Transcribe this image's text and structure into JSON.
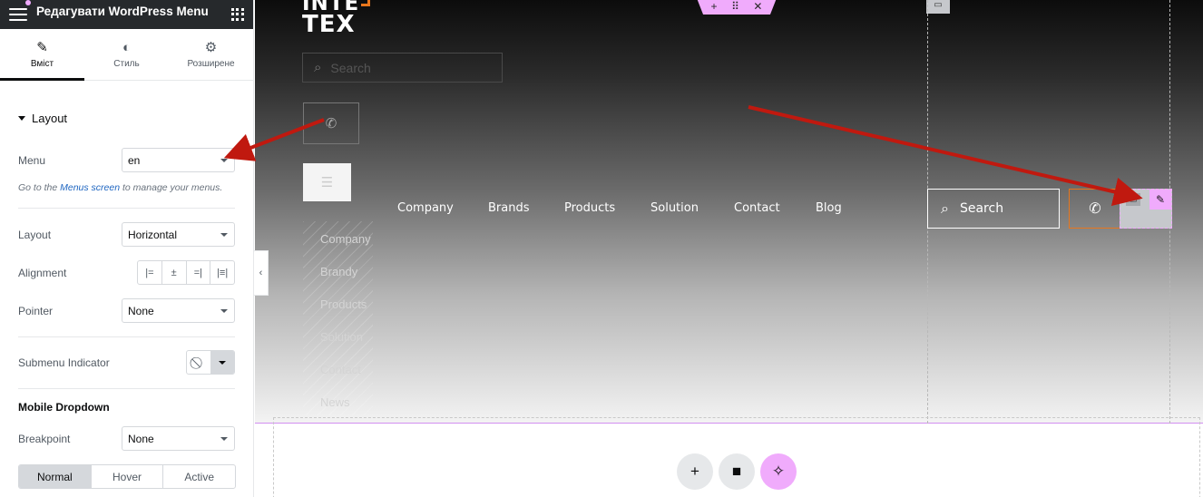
{
  "panel": {
    "title": "Редагувати WordPress Menu",
    "tabs": [
      {
        "label": "Вміст",
        "icon": "pencil-icon"
      },
      {
        "label": "Стиль",
        "icon": "contrast-icon"
      },
      {
        "label": "Розширене",
        "icon": "gear-icon"
      }
    ],
    "section": "Layout",
    "menu": {
      "label": "Menu",
      "value": "en"
    },
    "help": {
      "prefix": "Go to the",
      "link": "Menus screen",
      "suffix": "to manage your menus."
    },
    "layout": {
      "label": "Layout",
      "value": "Horizontal"
    },
    "alignment": {
      "label": "Alignment"
    },
    "pointer": {
      "label": "Pointer",
      "value": "None"
    },
    "submenu_indicator": {
      "label": "Submenu Indicator"
    },
    "mobile_dropdown": "Mobile Dropdown",
    "breakpoint": {
      "label": "Breakpoint",
      "value": "None"
    },
    "states": [
      "Normal",
      "Hover",
      "Active"
    ]
  },
  "canvas": {
    "logo_line1": "INTE",
    "logo_line2": "TEX",
    "mobile_search_placeholder": "Search",
    "mobile_menu": [
      "Company",
      "Brandy",
      "Products",
      "Solution",
      "Contact",
      "News"
    ],
    "nav": [
      "Company",
      "Brands",
      "Products",
      "Solution",
      "Contact",
      "Blog"
    ],
    "search_placeholder": "Search"
  },
  "colors": {
    "accent": "#f0abfc",
    "orange": "#e8761c",
    "arrow": "#c0190f"
  }
}
